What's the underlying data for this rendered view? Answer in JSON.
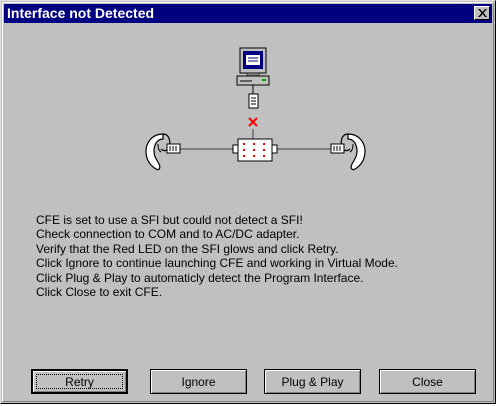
{
  "window": {
    "title": "Interface not Detected"
  },
  "message_lines": [
    "CFE is set to use a SFI but could not detect a SFI!",
    "Check connection to COM and to AC/DC adapter.",
    "Verify that the Red LED on the SFI glows and click Retry.",
    "Click Ignore to continue launching CFE and working in Virtual Mode.",
    "Click Plug & Play to automaticly detect the Program Interface.",
    "Click Close to exit CFE."
  ],
  "buttons": {
    "retry": "Retry",
    "ignore": "Ignore",
    "plug_and_play": "Plug & Play",
    "close": "Close"
  },
  "icons": {
    "title_close": "close-x-icon",
    "computer": "computer-icon",
    "connection_error": "red-x-icon",
    "interface": "interface-box-icon",
    "left_ear": "ear-icon",
    "right_ear": "ear-icon"
  },
  "colors": {
    "titlebar": "#000080",
    "dialog_face": "#c0c0c0",
    "error_mark": "#ff0000"
  }
}
